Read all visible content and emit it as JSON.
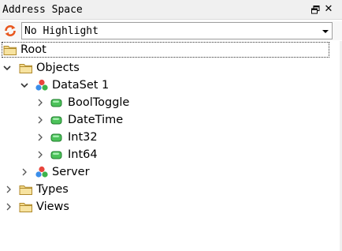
{
  "panel": {
    "title": "Address Space",
    "float_icon": "float-window-icon",
    "close_icon": "close-icon"
  },
  "toolbar": {
    "refresh_icon": "refresh-icon",
    "highlight_select": {
      "value": "No Highlight"
    }
  },
  "tree": {
    "root": {
      "label": "Root",
      "icon": "folder-icon"
    },
    "objects": {
      "label": "Objects",
      "icon": "folder-icon",
      "expanded": true
    },
    "dataset": {
      "label": "DataSet 1",
      "icon": "object-icon",
      "expanded": true
    },
    "variables": [
      {
        "label": "BoolToggle",
        "icon": "variable-icon"
      },
      {
        "label": "DateTime",
        "icon": "variable-icon"
      },
      {
        "label": "Int32",
        "icon": "variable-icon"
      },
      {
        "label": "Int64",
        "icon": "variable-icon"
      }
    ],
    "server": {
      "label": "Server",
      "icon": "object-icon"
    },
    "types": {
      "label": "Types",
      "icon": "folder-icon"
    },
    "views": {
      "label": "Views",
      "icon": "folder-icon"
    }
  },
  "colors": {
    "folder": "#e8c766",
    "variable": "#3cb44b",
    "accent": "#e8571f"
  }
}
